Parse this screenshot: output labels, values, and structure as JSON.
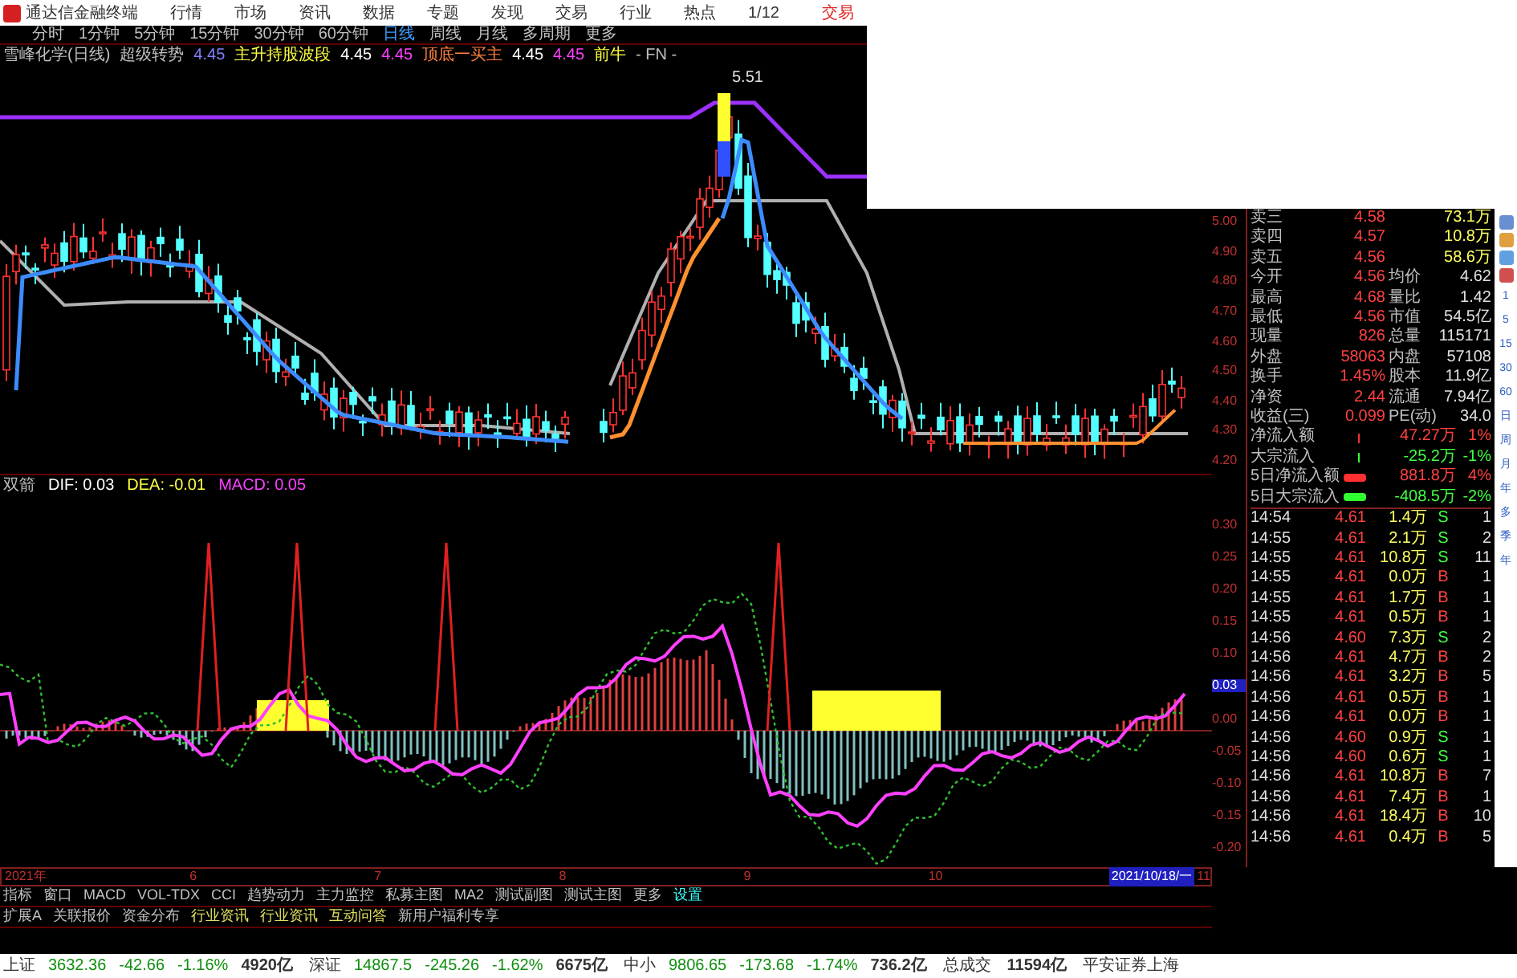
{
  "app": {
    "title": "通达信金融终端",
    "menu": [
      "行情",
      "市场",
      "资讯",
      "数据",
      "专题",
      "发现",
      "交易",
      "行业",
      "热点",
      "1/12"
    ],
    "trade_button": "交易"
  },
  "periods": [
    {
      "label": "分时",
      "selected": false
    },
    {
      "label": "1分钟",
      "selected": false
    },
    {
      "label": "5分钟",
      "selected": false
    },
    {
      "label": "15分钟",
      "selected": false
    },
    {
      "label": "30分钟",
      "selected": false
    },
    {
      "label": "60分钟",
      "selected": false
    },
    {
      "label": "日线",
      "selected": true
    },
    {
      "label": "周线",
      "selected": false
    },
    {
      "label": "月线",
      "selected": false
    },
    {
      "label": "多周期",
      "selected": false
    },
    {
      "label": "更多",
      "selected": false
    }
  ],
  "indicator_header": {
    "stock": "雪峰化学(日线)",
    "name": "超级转势",
    "items": [
      {
        "text": "4.45",
        "color": "#8080ff"
      },
      {
        "text": "主升持股波段",
        "color": "#ffff40"
      },
      {
        "text": "4.45",
        "color": "#ffffff"
      },
      {
        "text": "4.45",
        "color": "#ff40ff"
      },
      {
        "text": "顶底一买主",
        "color": "#ff8040"
      },
      {
        "text": "4.45",
        "color": "#ffffff"
      },
      {
        "text": "4.45",
        "color": "#ff40ff"
      },
      {
        "text": "前牛",
        "color": "#ffff40"
      },
      {
        "text": "- FN -",
        "color": "#c0c0c0"
      }
    ]
  },
  "main_chart": {
    "peak_label": "5.51",
    "price_axis": [
      "5.00",
      "4.90",
      "4.80",
      "4.70",
      "4.60",
      "4.50",
      "4.40",
      "4.30",
      "4.20"
    ]
  },
  "macd_header": {
    "name": "双箭",
    "items": [
      {
        "text": "DIF: 0.03",
        "color": "#ffffff"
      },
      {
        "text": "DEA: -0.01",
        "color": "#ffff40"
      },
      {
        "text": "MACD: 0.05",
        "color": "#ff40ff"
      }
    ]
  },
  "macd_axis": [
    {
      "label": "0.30",
      "selected": false
    },
    {
      "label": "0.25",
      "selected": false
    },
    {
      "label": "0.20",
      "selected": false
    },
    {
      "label": "0.15",
      "selected": false
    },
    {
      "label": "0.10",
      "selected": false
    },
    {
      "label": "0.03",
      "selected": true
    },
    {
      "label": "0.00",
      "selected": false
    },
    {
      "label": "-0.05",
      "selected": false
    },
    {
      "label": "-0.10",
      "selected": false
    },
    {
      "label": "-0.15",
      "selected": false
    },
    {
      "label": "-0.20",
      "selected": false
    }
  ],
  "asks": [
    {
      "label": "卖三",
      "price": "4.58",
      "volume": "73.1万"
    },
    {
      "label": "卖四",
      "price": "4.57",
      "volume": "10.8万"
    },
    {
      "label": "卖五",
      "price": "4.56",
      "volume": "58.6万"
    }
  ],
  "stats": [
    {
      "label": "今开",
      "value": "4.56",
      "label2": "均价",
      "value2": "4.62"
    },
    {
      "label": "最高",
      "value": "4.68",
      "label2": "量比",
      "value2": "1.42"
    },
    {
      "label": "最低",
      "value": "4.56",
      "label2": "市值",
      "value2": "54.5亿"
    },
    {
      "label": "现量",
      "value": "826",
      "label2": "总量",
      "value2": "115171"
    },
    {
      "label": "外盘",
      "value": "58063",
      "label2": "内盘",
      "value2": "57108"
    },
    {
      "label": "换手",
      "value": "1.45%",
      "label2": "股本",
      "value2": "11.9亿"
    },
    {
      "label": "净资",
      "value": "2.44",
      "label2": "流通",
      "value2": "7.94亿"
    },
    {
      "label": "收益(三)",
      "value": "0.099",
      "label2": "PE(动)",
      "value2": "34.0"
    }
  ],
  "flows": [
    {
      "label": "净流入额",
      "value": "47.27万",
      "percent": "1%",
      "kind": "in"
    },
    {
      "label": "大宗流入",
      "value": "-25.2万",
      "percent": "-1%",
      "kind": "out"
    },
    {
      "label": "5日净流入额",
      "value": "881.8万",
      "percent": "4%",
      "kind": "in-bar"
    },
    {
      "label": "5日大宗流入",
      "value": "-408.5万",
      "percent": "-2%",
      "kind": "out-bar"
    }
  ],
  "ticks": [
    {
      "time": "14:54",
      "price": "4.61",
      "volume": "1.4万",
      "side": "S",
      "count": "1",
      "kind": "sell"
    },
    {
      "time": "14:55",
      "price": "4.61",
      "volume": "2.1万",
      "side": "S",
      "count": "2",
      "kind": "sell"
    },
    {
      "time": "14:55",
      "price": "4.61",
      "volume": "10.8万",
      "side": "S",
      "count": "11",
      "kind": "sell"
    },
    {
      "time": "14:55",
      "price": "4.61",
      "volume": "0.0万",
      "side": "B",
      "count": "1",
      "kind": "buy"
    },
    {
      "time": "14:55",
      "price": "4.61",
      "volume": "1.7万",
      "side": "B",
      "count": "1",
      "kind": "buy"
    },
    {
      "time": "14:55",
      "price": "4.61",
      "volume": "0.5万",
      "side": "B",
      "count": "1",
      "kind": "buy"
    },
    {
      "time": "14:56",
      "price": "4.60",
      "volume": "7.3万",
      "side": "S",
      "count": "2",
      "kind": "sell"
    },
    {
      "time": "14:56",
      "price": "4.61",
      "volume": "4.7万",
      "side": "B",
      "count": "2",
      "kind": "buy"
    },
    {
      "time": "14:56",
      "price": "4.61",
      "volume": "3.2万",
      "side": "B",
      "count": "5",
      "kind": "buy"
    },
    {
      "time": "14:56",
      "price": "4.61",
      "volume": "0.5万",
      "side": "B",
      "count": "1",
      "kind": "buy"
    },
    {
      "time": "14:56",
      "price": "4.61",
      "volume": "0.0万",
      "side": "B",
      "count": "1",
      "kind": "buy"
    },
    {
      "time": "14:56",
      "price": "4.60",
      "volume": "0.9万",
      "side": "S",
      "count": "1",
      "kind": "sell"
    },
    {
      "time": "14:56",
      "price": "4.60",
      "volume": "0.6万",
      "side": "S",
      "count": "1",
      "kind": "sell"
    },
    {
      "time": "14:56",
      "price": "4.61",
      "volume": "10.8万",
      "side": "B",
      "count": "7",
      "kind": "buy"
    },
    {
      "time": "14:56",
      "price": "4.61",
      "volume": "7.4万",
      "side": "B",
      "count": "1",
      "kind": "buy"
    },
    {
      "time": "14:56",
      "price": "4.61",
      "volume": "18.4万",
      "side": "B",
      "count": "10",
      "kind": "buy"
    },
    {
      "time": "14:56",
      "price": "4.61",
      "volume": "0.4万",
      "side": "B",
      "count": "5",
      "kind": "buy"
    }
  ],
  "side_tools": [
    "1",
    "5",
    "15",
    "30",
    "60",
    "日",
    "周",
    "月",
    "年",
    "多",
    "季",
    "年"
  ],
  "date_axis": [
    "2021年",
    "6",
    "7",
    "8",
    "9",
    "10"
  ],
  "date_cursor": "2021/10/18/一",
  "date_after_cursor": "11",
  "tab_rows": [
    [
      {
        "label": "指标",
        "selected": false
      },
      {
        "label": "窗口",
        "selected": false
      },
      {
        "label": "MACD",
        "selected": false
      },
      {
        "label": "VOL-TDX",
        "selected": false
      },
      {
        "label": "CCI",
        "selected": false
      },
      {
        "label": "趋势动力",
        "selected": false
      },
      {
        "label": "主力监控",
        "selected": false
      },
      {
        "label": "私募主图",
        "selected": false
      },
      {
        "label": "MA2",
        "selected": false
      },
      {
        "label": "测试副图",
        "selected": false
      },
      {
        "label": "测试主图",
        "selected": false
      },
      {
        "label": "更多",
        "selected": false
      },
      {
        "label": "设置",
        "selected": true
      }
    ],
    [
      {
        "label": "扩展A",
        "selected": false
      },
      {
        "label": "关联报价",
        "selected": false
      },
      {
        "label": "资金分布",
        "selected": false
      },
      {
        "label": "行业资讯",
        "selected": true
      },
      {
        "label": "行业资讯",
        "selected": true
      },
      {
        "label": "互动问答",
        "selected": true
      },
      {
        "label": "新用户福利专享",
        "selected": false
      }
    ]
  ],
  "status_bar": {
    "indices": [
      {
        "name": "上证",
        "value": "3632.36",
        "change": "-42.66",
        "percent": "-1.16%",
        "amount": "4920亿"
      },
      {
        "name": "深证",
        "value": "14867.5",
        "change": "-245.26",
        "percent": "-1.62%",
        "amount": "6675亿"
      },
      {
        "name": "中小",
        "value": "9806.65",
        "change": "-173.68",
        "percent": "-1.74%",
        "amount": "736.2亿"
      }
    ],
    "total_label": "总成交",
    "total_value": "11594亿",
    "broker": "平安证券上海"
  }
}
